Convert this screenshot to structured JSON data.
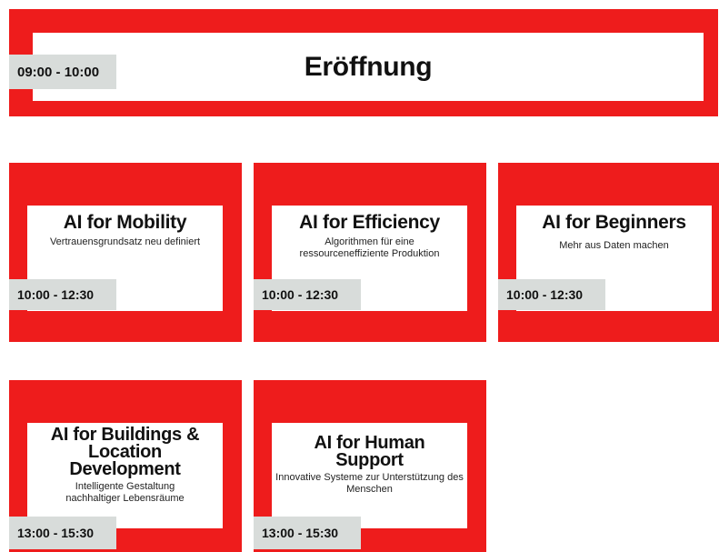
{
  "opening": {
    "time": "09:00 - 10:00",
    "title": "Eröffnung"
  },
  "sessions": [
    {
      "title": "AI for Mobility",
      "subtitle": "Vertrauensgrundsatz neu definiert",
      "time": "10:00 - 12:30"
    },
    {
      "title": "AI for Efficiency",
      "subtitle": "Algorithmen für eine ressourceneffiziente Produktion",
      "time": "10:00 - 12:30"
    },
    {
      "title": "AI for Beginners",
      "subtitle": "Mehr aus Daten machen",
      "time": "10:00 - 12:30"
    },
    {
      "title": "AI for Buildings & Location Development",
      "subtitle": "Intelligente Gestaltung nachhaltiger Lebensräume",
      "time": "13:00 - 15:30"
    },
    {
      "title": "AI for Human Support",
      "subtitle": "Innovative Systeme zur Unterstützung des Menschen",
      "time": "13:00 - 15:30"
    }
  ],
  "colors": {
    "card_red": "#ee1c1c",
    "time_badge": "#d8dcda"
  }
}
